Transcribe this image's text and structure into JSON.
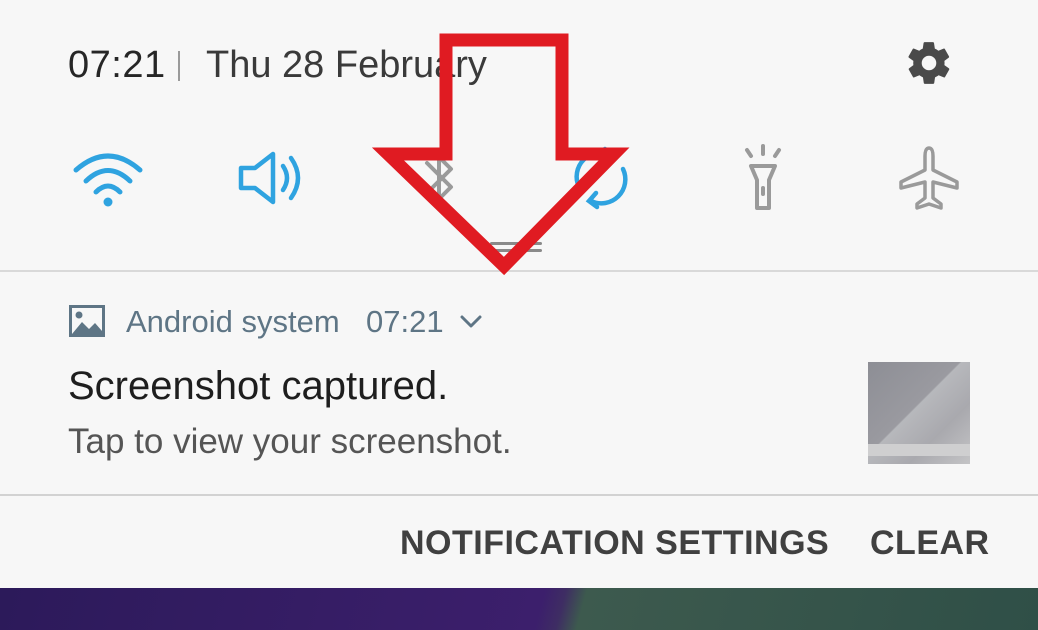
{
  "status": {
    "time": "07:21",
    "date": "Thu 28 February"
  },
  "header": {
    "settings_icon": "gear-icon"
  },
  "quick_settings": [
    {
      "name": "Wi-Fi",
      "icon": "wifi-icon",
      "active": true
    },
    {
      "name": "Sound",
      "icon": "sound-icon",
      "active": true
    },
    {
      "name": "Bluetooth",
      "icon": "bluetooth-icon",
      "active": false
    },
    {
      "name": "Auto rotate",
      "icon": "rotate-icon",
      "active": true
    },
    {
      "name": "Torch",
      "icon": "flashlight-icon",
      "active": false
    },
    {
      "name": "Flight mode",
      "icon": "airplane-icon",
      "active": false
    }
  ],
  "notification": {
    "app_name": "Android system",
    "time": "07:21",
    "title": "Screenshot captured.",
    "text": "Tap to view your screenshot."
  },
  "actions": {
    "settings_label": "NOTIFICATION SETTINGS",
    "clear_label": "CLEAR"
  },
  "colors": {
    "active_icon": "#2fa3e0",
    "inactive_icon": "#9a9a9a",
    "annotation_arrow": "#e01b22",
    "background": "#f7f7f7"
  }
}
